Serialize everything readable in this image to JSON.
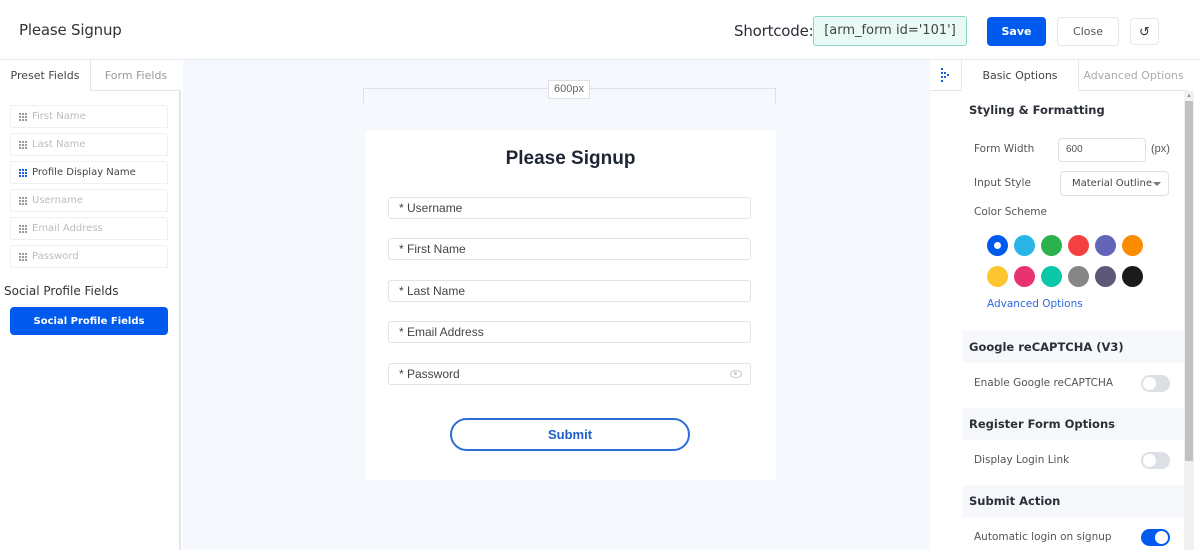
{
  "header": {
    "title": "Please Signup",
    "shortcode_label": "Shortcode:",
    "shortcode_value": "[arm_form id='101']",
    "save_label": "Save",
    "close_label": "Close",
    "reset_icon": "↺"
  },
  "left_panel": {
    "tabs": [
      {
        "label": "Preset Fields",
        "active": true
      },
      {
        "label": "Form Fields",
        "active": false
      }
    ],
    "fields": [
      {
        "label": "First Name",
        "enabled": false
      },
      {
        "label": "Last Name",
        "enabled": false
      },
      {
        "label": "Profile Display Name",
        "enabled": true
      },
      {
        "label": "Username",
        "enabled": false
      },
      {
        "label": "Email Address",
        "enabled": false
      },
      {
        "label": "Password",
        "enabled": false
      }
    ],
    "social_title": "Social Profile Fields",
    "social_button": "Social Profile Fields"
  },
  "canvas": {
    "ruler_label": "600px",
    "form_title": "Please Signup",
    "inputs": [
      {
        "label": "* Username"
      },
      {
        "label": "* First Name"
      },
      {
        "label": "* Last Name"
      },
      {
        "label": "* Email Address"
      },
      {
        "label": "* Password",
        "has_eye_icon": true
      }
    ],
    "submit_label": "Submit"
  },
  "right_panel": {
    "tabs": [
      {
        "label": "Basic Options",
        "active": true
      },
      {
        "label": "Advanced Options",
        "active": false
      }
    ],
    "styling": {
      "heading": "Styling & Formatting",
      "form_width_label": "Form Width",
      "form_width_value": "600",
      "form_width_unit": "(px)",
      "input_style_label": "Input Style",
      "input_style_value": "Material Outline",
      "color_scheme_label": "Color Scheme",
      "colors": [
        "#005aee",
        "#29b6e6",
        "#2bb24c",
        "#f44040",
        "#6366b8",
        "#fb8c00",
        "#fdc52e",
        "#e8336e",
        "#0bc8a8",
        "#868686",
        "#5c5878",
        "#1a1a1a"
      ],
      "selected_color_index": 0,
      "advanced_link": "Advanced Options"
    },
    "recaptcha": {
      "heading": "Google reCAPTCHA (V3)",
      "enable_label": "Enable Google reCAPTCHA",
      "enabled": false
    },
    "register": {
      "heading": "Register Form Options",
      "login_link_label": "Display Login Link",
      "login_link_enabled": false
    },
    "submit_action": {
      "heading": "Submit Action",
      "auto_login_label": "Automatic login on signup",
      "auto_login_enabled": true
    }
  }
}
